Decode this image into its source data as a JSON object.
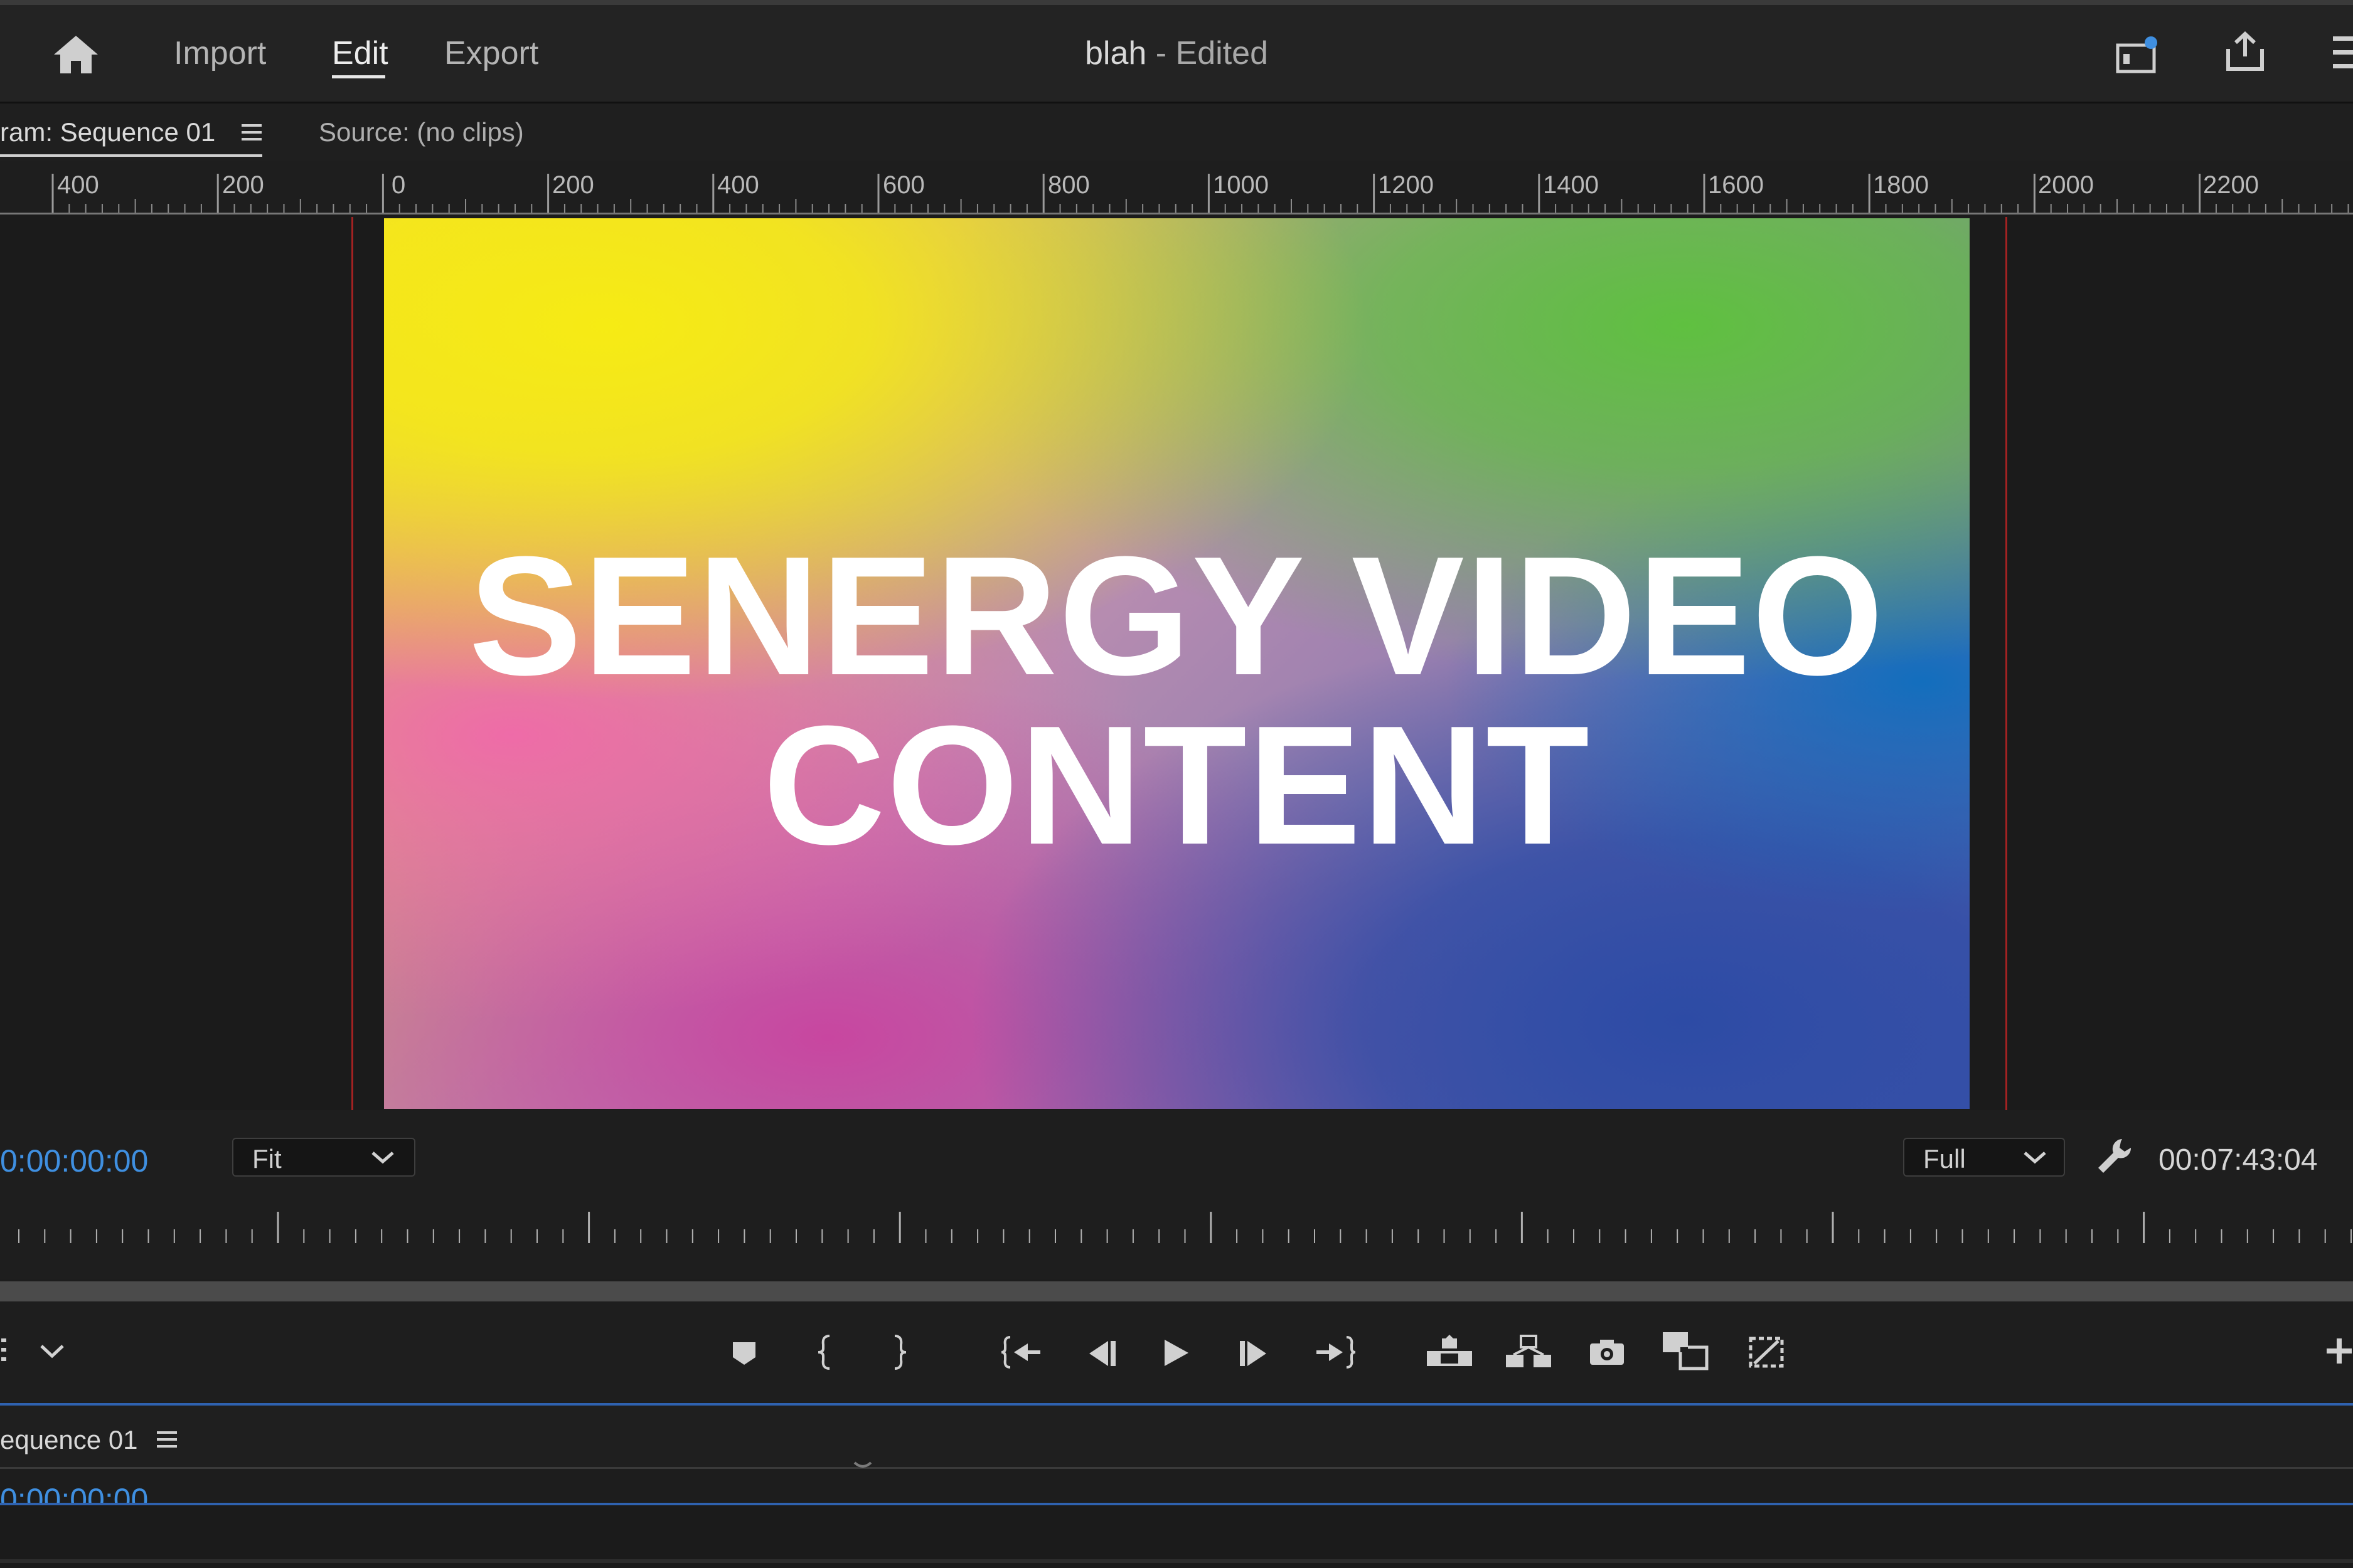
{
  "header": {
    "nav": {
      "import": "Import",
      "edit": "Edit",
      "export": "Export"
    },
    "title": "blah",
    "title_status": " - Edited"
  },
  "panels": {
    "program_tab": "ram: Sequence 01",
    "source_tab": "Source: (no clips)"
  },
  "ruler": {
    "labels": [
      "400",
      "200",
      "0",
      "200",
      "400",
      "600",
      "800",
      "1000",
      "1200",
      "1400",
      "1600",
      "1800",
      "2000",
      "2200"
    ]
  },
  "viewer": {
    "headline_line1": "SENERGY VIDEO",
    "headline_line2": "CONTENT"
  },
  "program_controls": {
    "current_timecode": "0:00:00:00",
    "zoom_value": "Fit",
    "resolution_value": "Full",
    "duration_timecode": "00:07:43:04"
  },
  "transport": {
    "icons": [
      "add-marker-icon",
      "mark-in-icon",
      "mark-out-icon",
      "go-to-in-icon",
      "step-back-icon",
      "play-icon",
      "step-forward-icon",
      "go-to-out-icon",
      "lift-icon",
      "extract-icon",
      "export-frame-icon",
      "comparison-view-icon",
      "toggle-proxies-icon",
      "add-button-icon"
    ]
  },
  "timeline": {
    "sequence_tab": "equence 01",
    "timecode": "0:00:00:00"
  },
  "colors": {
    "timecode_blue": "#3f8fe0",
    "safe_margin_red": "#a32222",
    "panel_bg": "#1d1d1d"
  }
}
